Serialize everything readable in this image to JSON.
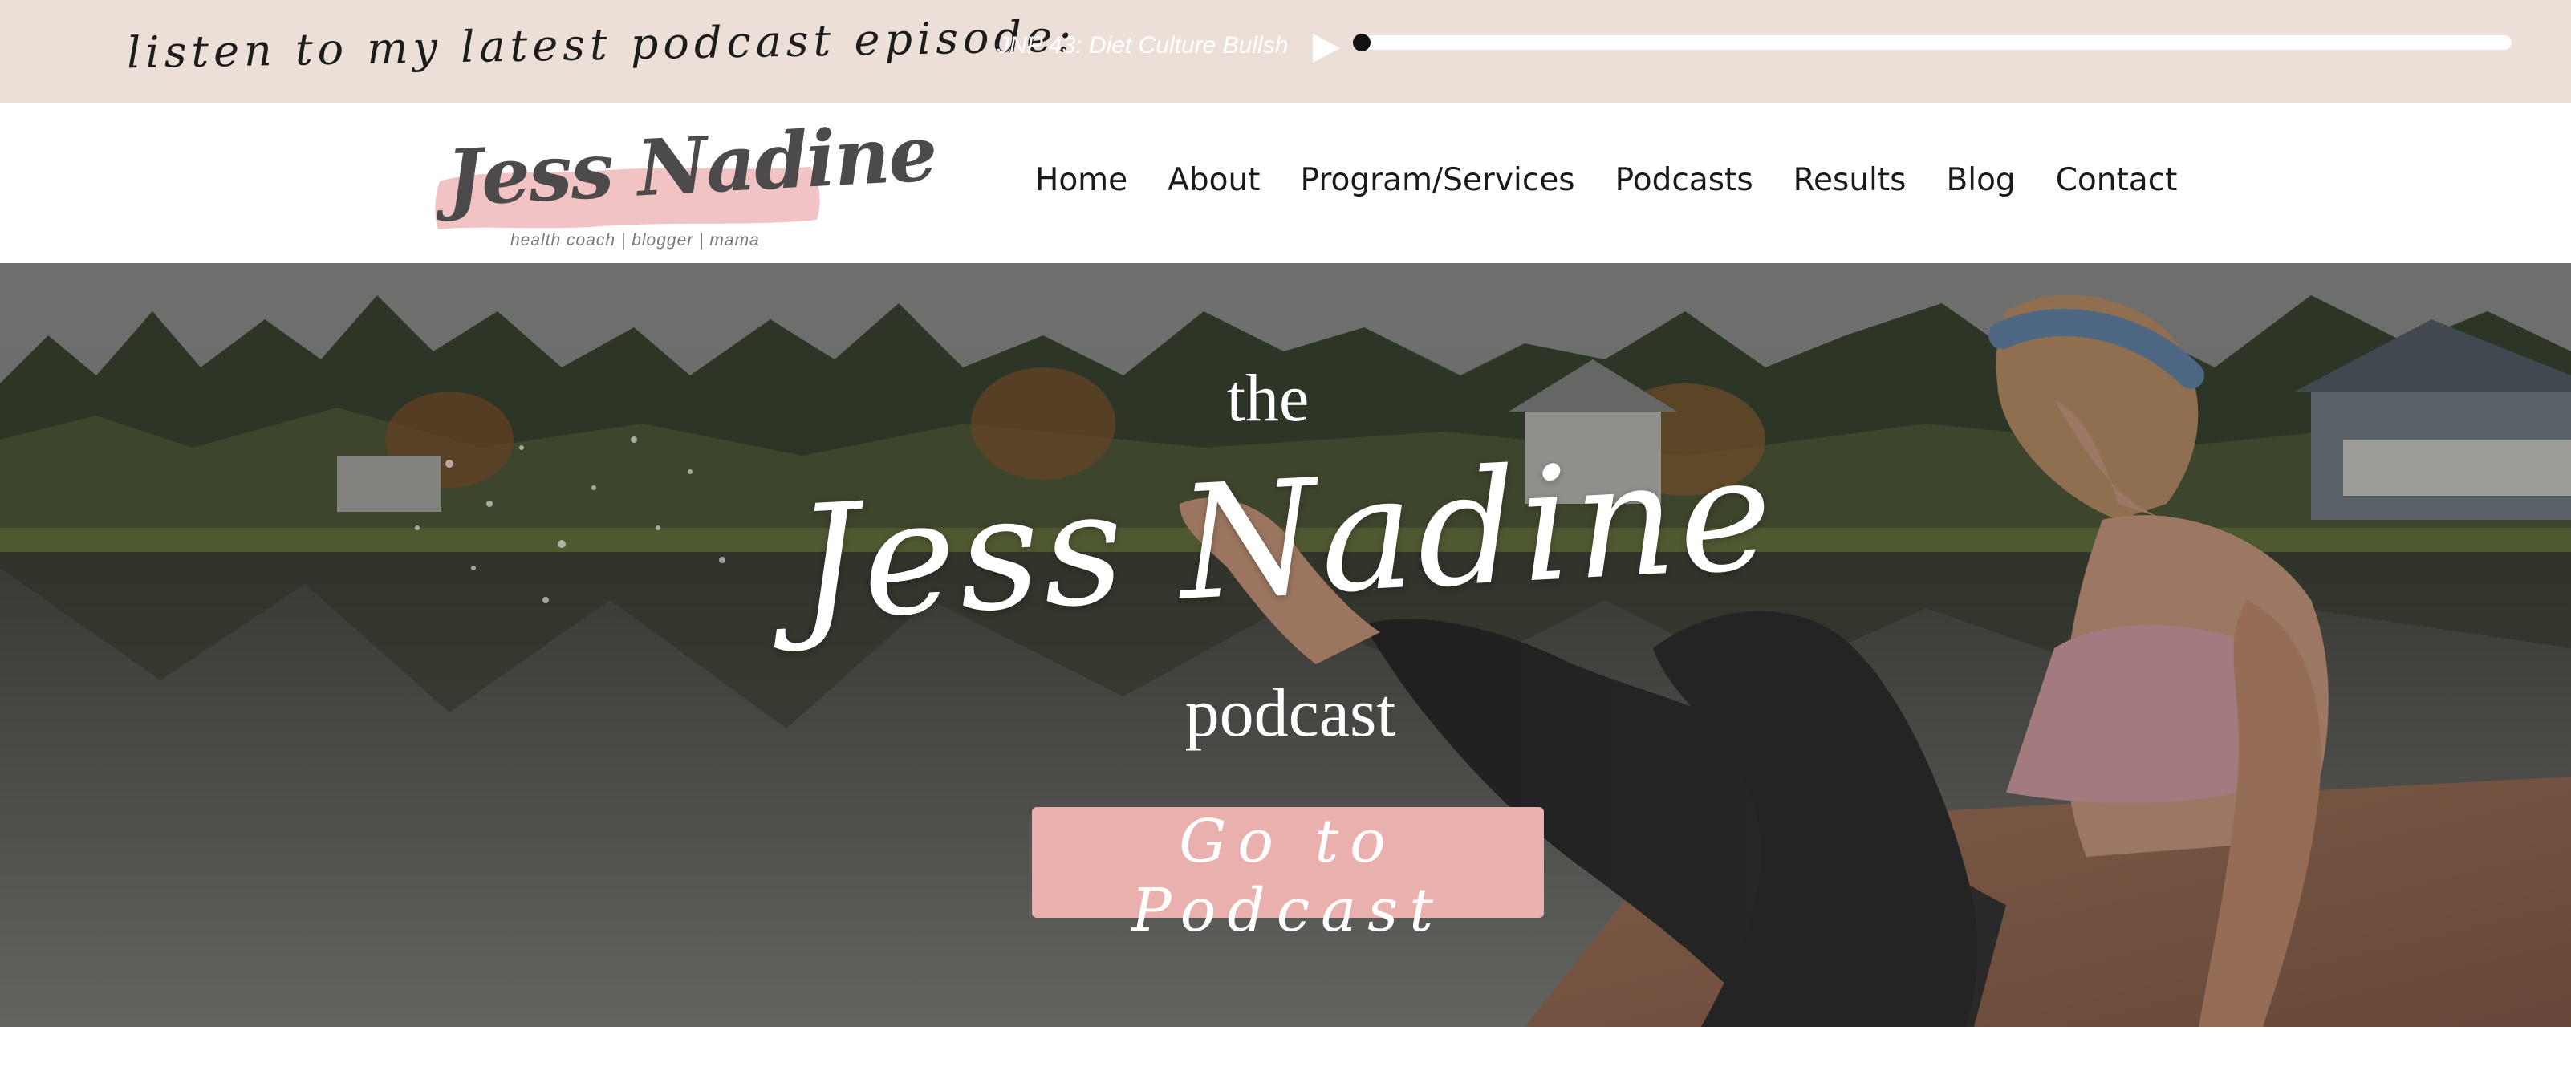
{
  "podcast_bar": {
    "promo_text": "listen to my latest podcast episode:",
    "episode_title": "JNP 43: Diet Culture Bullsh",
    "play_icon": "play-icon",
    "progress": 0.0,
    "bar_color": "#ecdfd8"
  },
  "header": {
    "logo": {
      "name": "Jess Nadine",
      "tagline": "health coach | blogger | mama",
      "brush_color": "#f2c3c4"
    },
    "nav": [
      {
        "label": "Home"
      },
      {
        "label": "About"
      },
      {
        "label": "Program/Services"
      },
      {
        "label": "Podcasts"
      },
      {
        "label": "Results"
      },
      {
        "label": "Blog"
      },
      {
        "label": "Contact"
      }
    ]
  },
  "hero": {
    "line1": "the",
    "name": "Jess Nadine",
    "line3": "podcast",
    "cta_label": "Go to Podcast",
    "cta_color": "#e9b0ae"
  }
}
